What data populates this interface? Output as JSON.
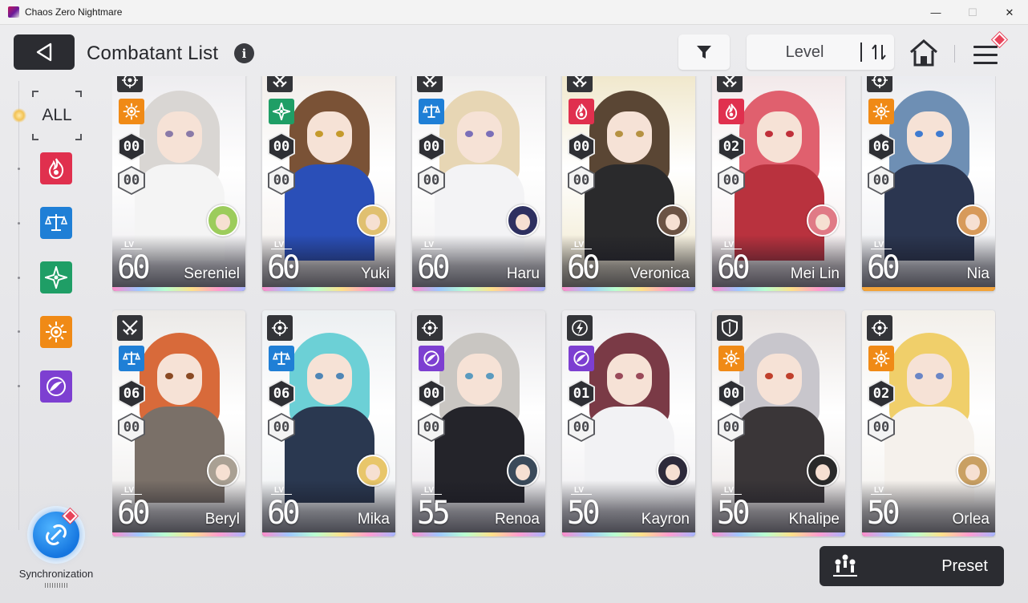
{
  "window": {
    "title": "Chaos Zero Nightmare",
    "minimize": "—",
    "maximize": "☐",
    "close": "✕"
  },
  "header": {
    "title": "Combatant List",
    "info": "i",
    "sort_label": "Level"
  },
  "sidebar": {
    "all_label": "ALL",
    "filters": [
      {
        "name": "passion",
        "color": "#e0304e"
      },
      {
        "name": "order",
        "color": "#1f7fd6"
      },
      {
        "name": "justice",
        "color": "#1f9e66"
      },
      {
        "name": "instinct",
        "color": "#f08a16"
      },
      {
        "name": "void",
        "color": "#7d3fd1"
      }
    ],
    "sync_label": "Synchronization"
  },
  "preset_label": "Preset",
  "colors": {
    "rarity_5": "linear-gradient(90deg,#ff8cc8,#9ec7ff,#b9ffd0,#ffe08a,#ff9ccf,#a6b6ff)",
    "rarity_4": "#f2a33a"
  },
  "characters": [
    {
      "name": "Sereniel",
      "level": "60",
      "rank": "00",
      "potential": "00",
      "class_icon": "crosshair-icon",
      "element": "instinct",
      "element_color": "#f08a16",
      "hair": "#d9d6d3",
      "body": "#f4f4f4",
      "bg": "#ecebee",
      "eye": "#8a7aa8",
      "partner_hair": "#9ccc5c",
      "rarity": 5
    },
    {
      "name": "Yuki",
      "level": "60",
      "rank": "00",
      "potential": "00",
      "class_icon": "crossed-swords-icon",
      "element": "justice",
      "element_color": "#1f9e66",
      "hair": "#7a5236",
      "body": "#2a4fb8",
      "bg": "#f1ece8",
      "eye": "#c59a2c",
      "partner_hair": "#e0c070",
      "rarity": 5
    },
    {
      "name": "Haru",
      "level": "60",
      "rank": "00",
      "potential": "00",
      "class_icon": "crossed-swords-icon",
      "element": "order",
      "element_color": "#1f7fd6",
      "hair": "#e7d6b4",
      "body": "#f3f3f5",
      "bg": "#efeeef",
      "eye": "#7b6fb8",
      "partner_hair": "#2e3060",
      "rarity": 5
    },
    {
      "name": "Veronica",
      "level": "60",
      "rank": "00",
      "potential": "00",
      "class_icon": "crossed-swords-icon",
      "element": "passion",
      "element_color": "#e0304e",
      "hair": "#5a4634",
      "body": "#2a2a2c",
      "bg": "#efe6c8",
      "eye": "#b69242",
      "partner_hair": "#6b5344",
      "rarity": 5
    },
    {
      "name": "Mei Lin",
      "level": "60",
      "rank": "02",
      "potential": "00",
      "class_icon": "crossed-swords-icon",
      "element": "passion",
      "element_color": "#e0304e",
      "hair": "#e0606e",
      "body": "#b9323e",
      "bg": "#f1e7e8",
      "eye": "#c0303a",
      "partner_hair": "#e07a86",
      "rarity": 5
    },
    {
      "name": "Nia",
      "level": "60",
      "rank": "06",
      "potential": "00",
      "class_icon": "crosshair-icon",
      "element": "instinct",
      "element_color": "#f08a16",
      "hair": "#6e8fb4",
      "body": "#2b3650",
      "bg": "#e9eaee",
      "eye": "#3f7bd0",
      "partner_hair": "#d79a5a",
      "rarity": 4
    },
    {
      "name": "Beryl",
      "level": "60",
      "rank": "06",
      "potential": "00",
      "class_icon": "crossed-swords-icon",
      "element": "order",
      "element_color": "#1f7fd6",
      "hair": "#d86a3a",
      "body": "#7a7068",
      "bg": "#ebe9e7",
      "eye": "#8a4a24",
      "partner_hair": "#a9a093",
      "rarity": 5
    },
    {
      "name": "Mika",
      "level": "60",
      "rank": "06",
      "potential": "00",
      "class_icon": "crosshair-icon",
      "element": "order",
      "element_color": "#1f7fd6",
      "hair": "#6cd0d6",
      "body": "#2a3850",
      "bg": "#eceff1",
      "eye": "#4f86b6",
      "partner_hair": "#e8c66a",
      "rarity": 5
    },
    {
      "name": "Renoa",
      "level": "55",
      "rank": "00",
      "potential": "00",
      "class_icon": "crosshair-icon",
      "element": "void",
      "element_color": "#7d3fd1",
      "hair": "#c9c6c2",
      "body": "#24242a",
      "bg": "#e6e5e8",
      "eye": "#5b9bbf",
      "partner_hair": "#3a4a5a",
      "rarity": 5
    },
    {
      "name": "Kayron",
      "level": "50",
      "rank": "01",
      "potential": "00",
      "class_icon": "lightning-icon",
      "element": "void",
      "element_color": "#7d3fd1",
      "hair": "#7a3a46",
      "body": "#f2f2f4",
      "bg": "#ecebee",
      "eye": "#9a4a5a",
      "partner_hair": "#2d2a3a",
      "rarity": 5
    },
    {
      "name": "Khalipe",
      "level": "50",
      "rank": "00",
      "potential": "00",
      "class_icon": "shield-icon",
      "element": "instinct",
      "element_color": "#f08a16",
      "hair": "#c8c6cc",
      "body": "#3a3638",
      "bg": "#e9e4e2",
      "eye": "#c0402c",
      "partner_hair": "#2a2a2a",
      "rarity": 5
    },
    {
      "name": "Orlea",
      "level": "50",
      "rank": "02",
      "potential": "00",
      "class_icon": "crosshair-icon",
      "element": "instinct",
      "element_color": "#f08a16",
      "hair": "#f0cf6a",
      "body": "#f5f1ec",
      "bg": "#f2efea",
      "eye": "#6a86c6",
      "partner_hair": "#c9a063",
      "rarity": 5
    }
  ]
}
